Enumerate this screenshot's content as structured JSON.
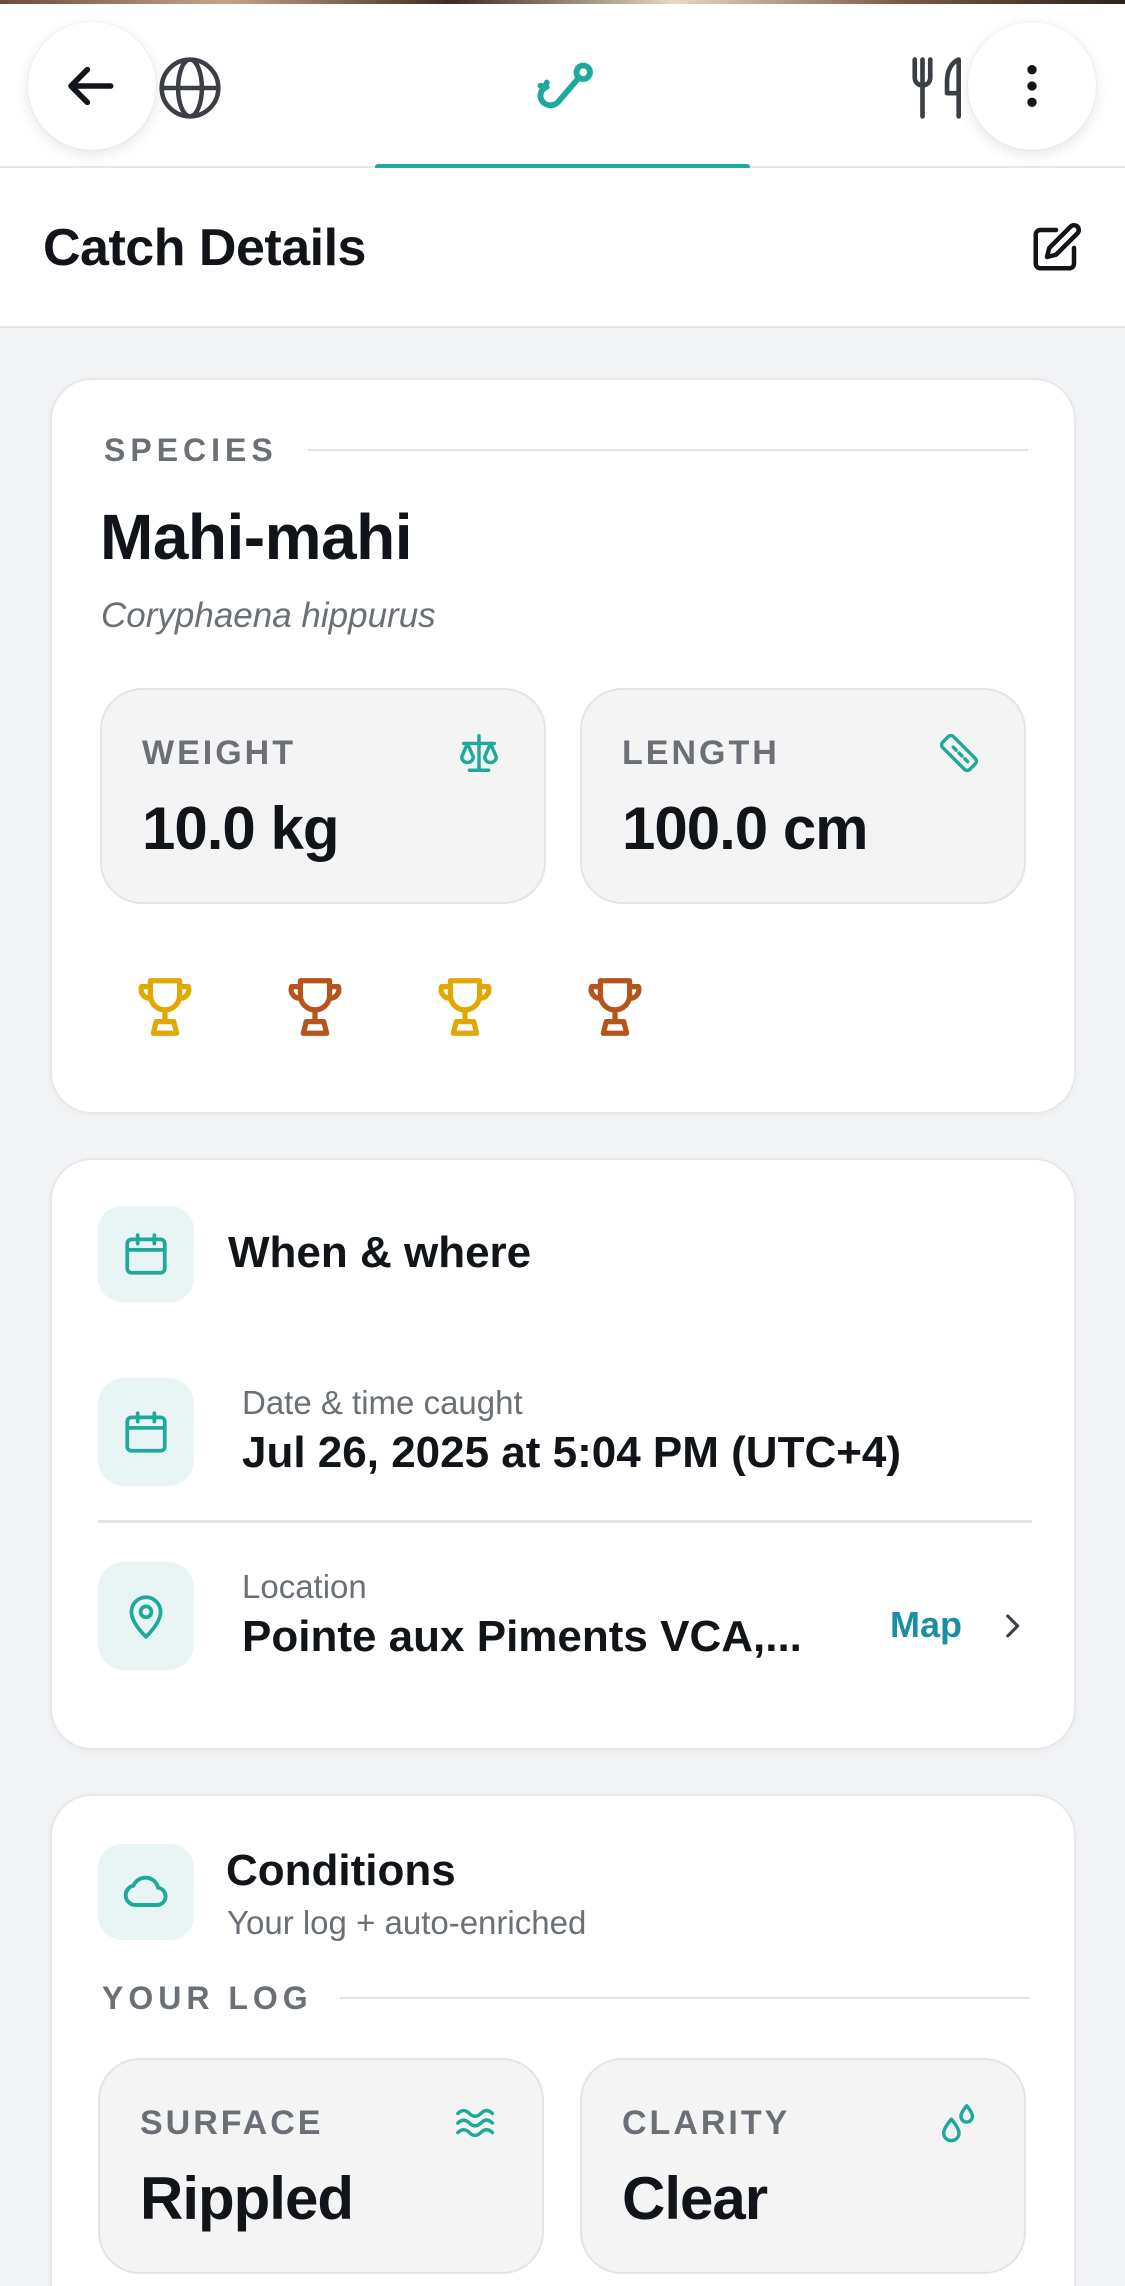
{
  "topbar": {
    "back_icon": "arrow-left-icon",
    "globe_icon": "globe-icon",
    "active_tab_icon": "fishing-hook-icon",
    "cutlery_icon": "fork-knife-icon",
    "more_icon": "more-vertical-icon",
    "accent_color": "#1fa99a"
  },
  "header": {
    "title": "Catch Details",
    "edit_icon": "edit-icon"
  },
  "species": {
    "eyebrow": "SPECIES",
    "name": "Mahi-mahi",
    "scientific_name": "Coryphaena hippurus",
    "weight_label": "WEIGHT",
    "weight_value": "10.0 kg",
    "weight_icon": "scale-icon",
    "length_label": "LENGTH",
    "length_value": "100.0 cm",
    "length_icon": "ruler-icon",
    "trophies": [
      {
        "icon": "trophy-icon",
        "color": "#e0a800"
      },
      {
        "icon": "trophy-icon",
        "color": "#b5541b"
      },
      {
        "icon": "trophy-icon",
        "color": "#e0a800"
      },
      {
        "icon": "trophy-icon",
        "color": "#b5541b"
      }
    ]
  },
  "when_where": {
    "heading": "When & where",
    "heading_icon": "calendar-icon",
    "date_label": "Date & time caught",
    "date_value": "Jul 26, 2025 at 5:04 PM (UTC+4)",
    "date_icon": "calendar-icon",
    "location_label": "Location",
    "location_value": "Pointe aux Piments VCA,...",
    "location_icon": "map-pin-icon",
    "map_link": "Map",
    "link_color": "#1b8fa2"
  },
  "conditions": {
    "heading": "Conditions",
    "heading_icon": "cloud-icon",
    "subtitle": "Your log + auto-enriched",
    "eyebrow": "YOUR LOG",
    "surface_label": "SURFACE",
    "surface_value": "Rippled",
    "surface_icon": "waves-icon",
    "clarity_label": "CLARITY",
    "clarity_value": "Clear",
    "clarity_icon": "droplets-icon"
  }
}
